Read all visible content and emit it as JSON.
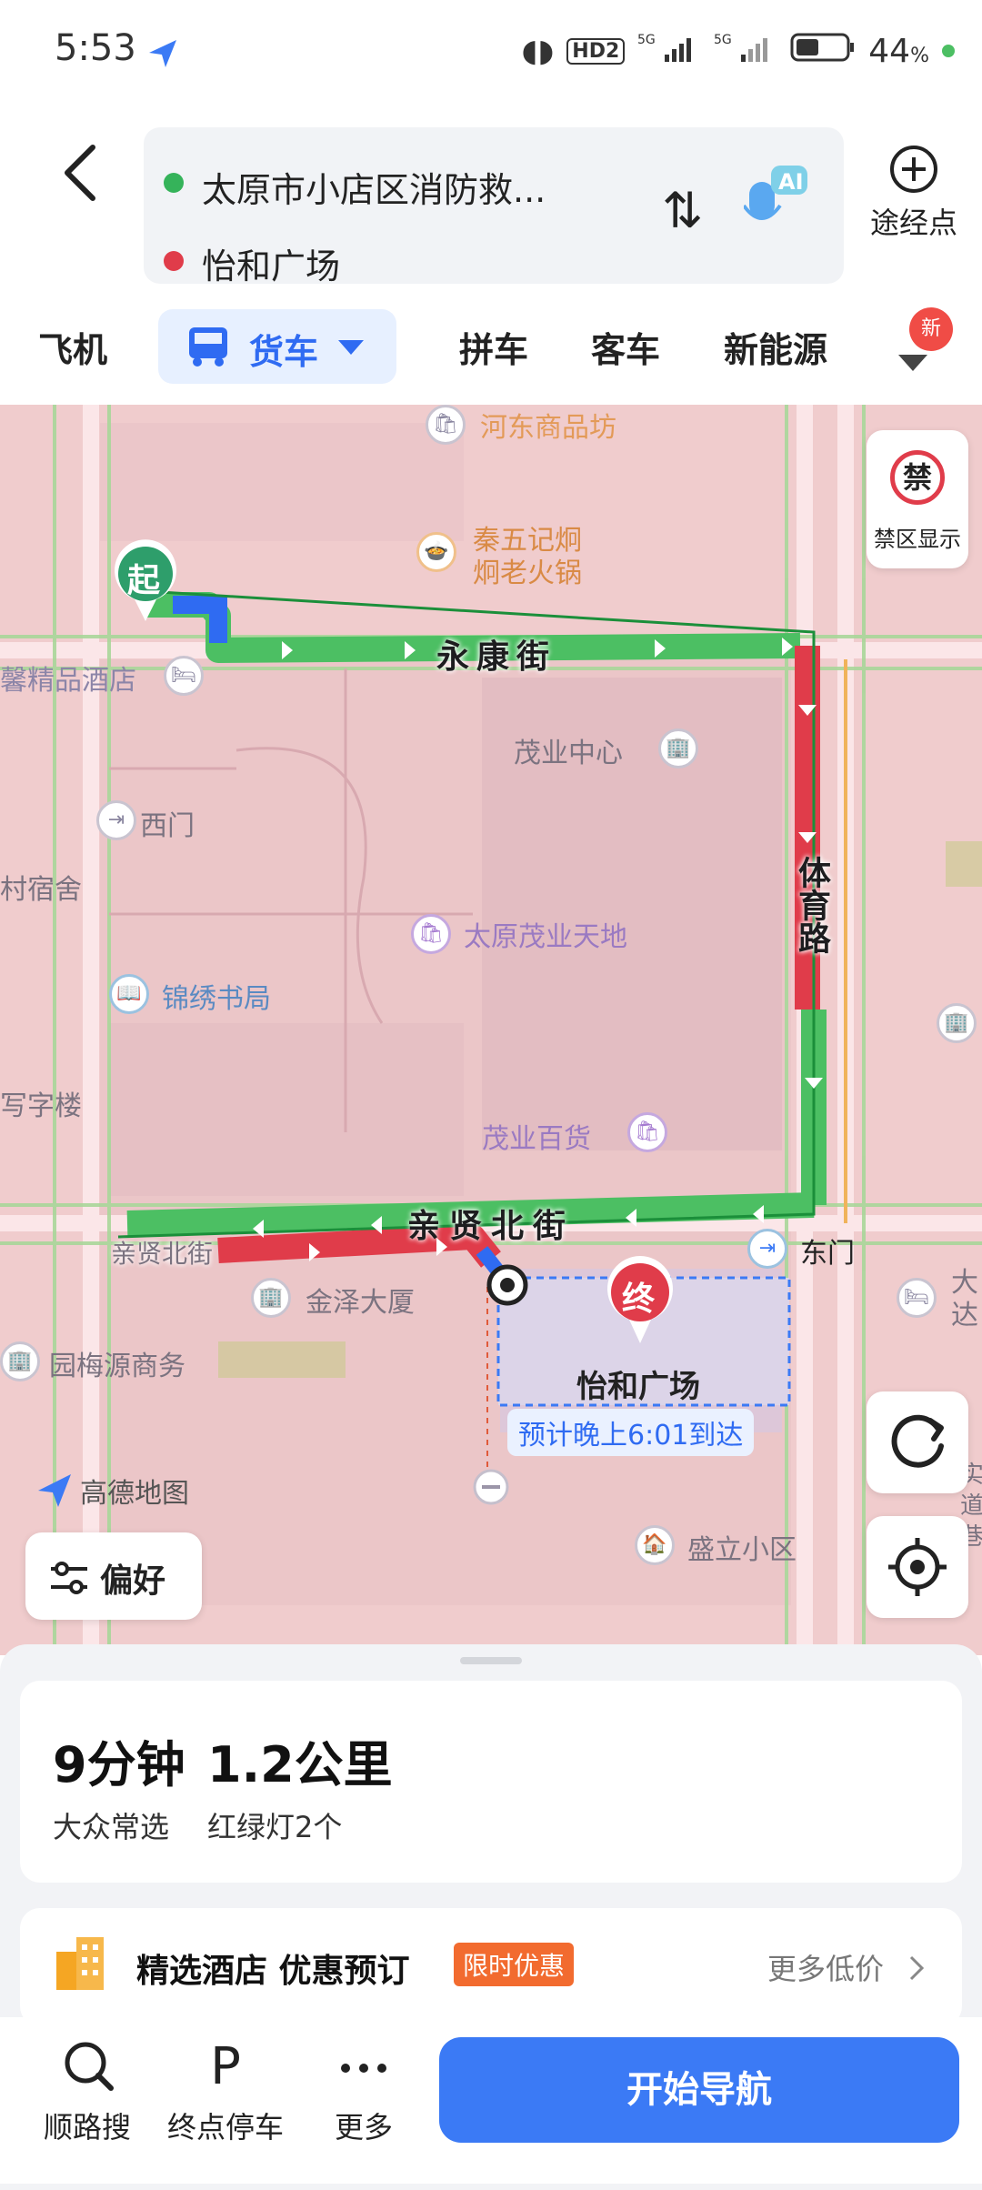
{
  "status_bar": {
    "time": "5:53",
    "battery": "44",
    "battery_unit": "%",
    "network": "5G",
    "hd": "HD2"
  },
  "header": {
    "origin": "太原市小店区消防救...",
    "destination": "怡和广场",
    "via_label": "途经点",
    "ai_label": "AI"
  },
  "modes": {
    "plane": "飞机",
    "truck": "货车",
    "carpool": "拼车",
    "coach": "客车",
    "new_energy": "新能源",
    "new_badge": "新"
  },
  "map": {
    "pois": {
      "hedong": "河东商品坊",
      "qinwuji_1": "秦五记炯",
      "qinwuji_2": "炯老火锅",
      "hotel": "馨精品酒店",
      "maoye_center": "茂业中心",
      "west_gate": "西门",
      "dorm": "村宿舍",
      "maoye_tiandi": "太原茂业天地",
      "bookstore": "锦绣书局",
      "office": "写字楼",
      "maoye_store": "茂业百货",
      "east_gate": "东门",
      "jinze": "金泽大厦",
      "meiyuan": "园梅源商务",
      "shengli": "盛立小区",
      "right_edge_1": "大",
      "right_edge_2": "达",
      "right_edge_3": "实",
      "right_edge_4": "道",
      "right_edge_5": "巷"
    },
    "roads": {
      "yongkang": "永康街",
      "tiyu": "体育路",
      "qinxian": "亲贤北街",
      "qinxian_small": "亲贤北街"
    },
    "start_marker": "起",
    "end_marker": "终",
    "destination_name": "怡和广场",
    "eta": "预计晚上6:01到达",
    "watermark": "高德地图",
    "restricted_label": "禁区显示",
    "restricted_icon": "禁",
    "preference_label": "偏好"
  },
  "route_card": {
    "duration": "9分钟",
    "distance": "1.2公里",
    "tag": "大众常选",
    "lights": "红绿灯2个"
  },
  "hotel_card": {
    "title": "精选酒店 优惠预订",
    "badge": "限时优惠",
    "more": "更多低价"
  },
  "bottom_bar": {
    "search_along": "顺路搜",
    "parking": "终点停车",
    "parking_icon": "P",
    "more": "更多",
    "start_nav": "开始导航"
  },
  "colors": {
    "accent": "#3b7af5",
    "traffic_green": "#4cbf63",
    "traffic_red": "#e03c4a",
    "map_bg": "#f0cccd"
  }
}
